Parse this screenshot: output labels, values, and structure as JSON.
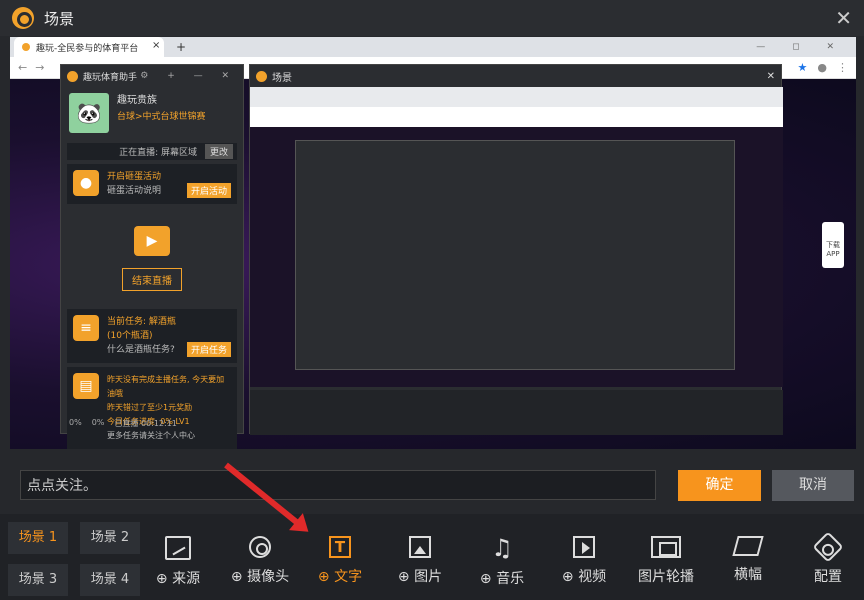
{
  "window": {
    "title": "场景",
    "close": "✕"
  },
  "browser": {
    "tab_title": "趣玩-全民参与的体育平台",
    "tab_close": "×",
    "new_tab": "+",
    "window_controls": "— ◻ ✕",
    "nav_back": "←",
    "nav_forward": "→",
    "star": "★",
    "qr_label": "下载",
    "qr_label2": "APP"
  },
  "assistant": {
    "title": "趣玩体育助手",
    "header_icons": "⚙ + — ✕",
    "user_name": "趣玩贵族",
    "category": "台球>中式台球世锦赛",
    "live_status": "正在直播: 屏幕区域",
    "change_button": "更改",
    "egg_card": {
      "title": "开启砸蛋活动",
      "sub": "砸蛋活动说明",
      "button": "开启活动"
    },
    "end_live": "结束直播",
    "task_card": {
      "title": "当前任务: 解酒瓶 (10个瓶酒)",
      "sub": "什么是酒瓶任务?",
      "button": "开启任务"
    },
    "host_card": {
      "line1": "昨天没有完成主播任务, 今天要加油哦",
      "line2": "昨天错过了至少1元奖励",
      "line3": "今日任务进度:    0% LV1",
      "line4": "更多任务请关注个人中心"
    },
    "footer": {
      "signal": "0%",
      "fps": "0%",
      "duration": "已直播 00:12:11"
    }
  },
  "nested_window": {
    "title": "场景",
    "close": "✕"
  },
  "comment": {
    "value": "点点关注。"
  },
  "actions": {
    "confirm": "确定",
    "cancel": "取消"
  },
  "scenes": [
    "场景 1",
    "场景 2",
    "场景 3",
    "场景 4"
  ],
  "tools": [
    {
      "label": "⊕ 来源",
      "icon": "source-icon"
    },
    {
      "label": "⊕ 摄像头",
      "icon": "camera-icon"
    },
    {
      "label": "⊕ 文字",
      "icon": "text-icon"
    },
    {
      "label": "⊕ 图片",
      "icon": "image-icon"
    },
    {
      "label": "⊕ 音乐",
      "icon": "music-icon"
    },
    {
      "label": "⊕ 视频",
      "icon": "video-icon"
    },
    {
      "label": "图片轮播",
      "icon": "carousel-icon"
    },
    {
      "label": "横幅",
      "icon": "banner-icon"
    },
    {
      "label": "配置",
      "icon": "config-icon"
    }
  ],
  "colors": {
    "accent": "#f7941d",
    "bg": "#26282c",
    "toolbar": "#202226",
    "annotation_arrow": "#e02a2a"
  }
}
